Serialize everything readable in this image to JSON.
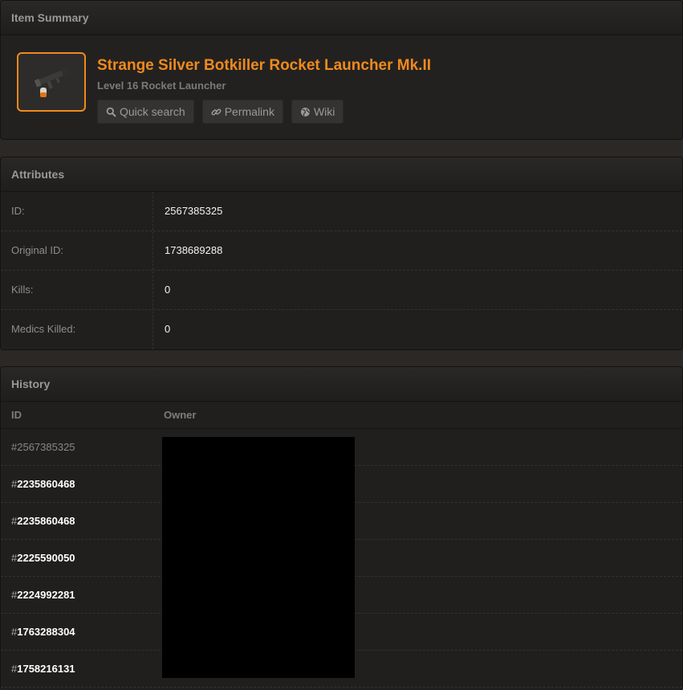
{
  "summary": {
    "header": "Item Summary",
    "title": "Strange Silver Botkiller Rocket Launcher Mk.II",
    "subtitle": "Level 16 Rocket Launcher",
    "buttons": {
      "quick_search": "Quick search",
      "permalink": "Permalink",
      "wiki": "Wiki"
    },
    "accent_color": "#f08a1c"
  },
  "attributes": {
    "header": "Attributes",
    "rows": [
      {
        "key": "ID:",
        "value": "2567385325"
      },
      {
        "key": "Original ID:",
        "value": "1738689288"
      },
      {
        "key": "Kills:",
        "value": "0"
      },
      {
        "key": "Medics Killed:",
        "value": "0"
      }
    ]
  },
  "history": {
    "header": "History",
    "columns": {
      "id": "ID",
      "owner": "Owner"
    },
    "rows": [
      {
        "hash": "#",
        "id": "2567385325"
      },
      {
        "hash": "#",
        "id": "2235860468"
      },
      {
        "hash": "#",
        "id": "2235860468"
      },
      {
        "hash": "#",
        "id": "2225590050"
      },
      {
        "hash": "#",
        "id": "2224992281"
      },
      {
        "hash": "#",
        "id": "1763288304"
      },
      {
        "hash": "#",
        "id": "1758216131"
      }
    ]
  }
}
